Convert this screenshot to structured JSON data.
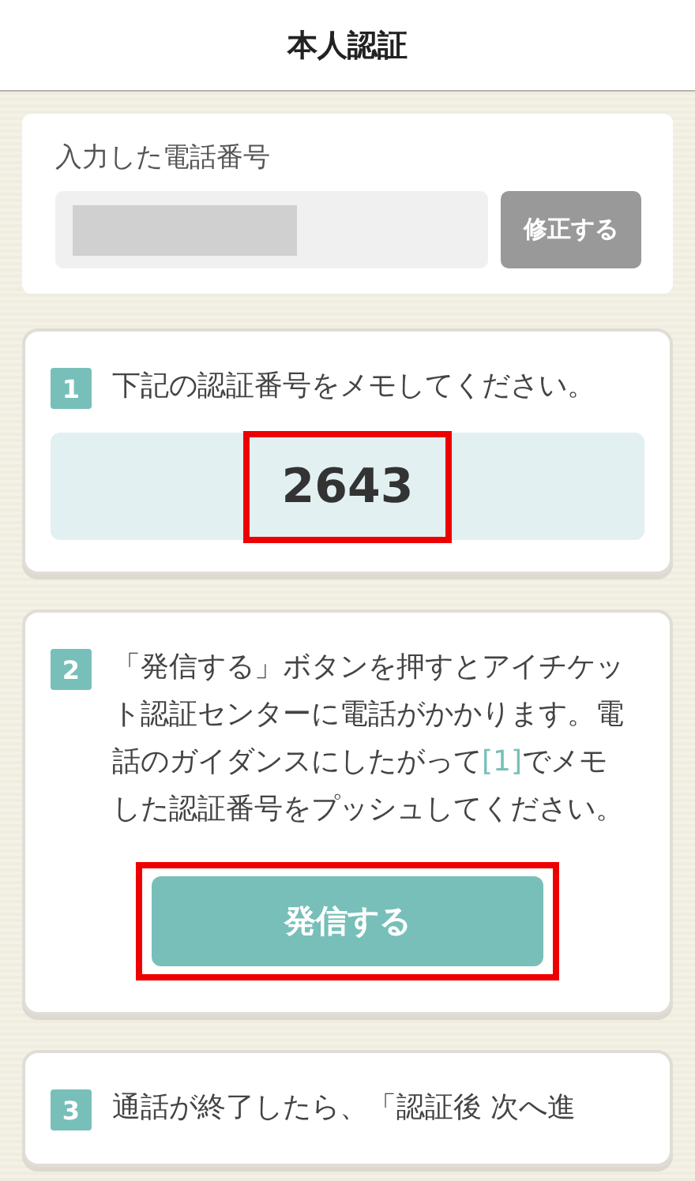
{
  "header": {
    "title": "本人認証"
  },
  "phone": {
    "label": "入力した電話番号",
    "edit_button": "修正する"
  },
  "steps": [
    {
      "kind": "code",
      "number": "1",
      "text": "下記の認証番号をメモしてください。",
      "code": "2643",
      "highlighted": true
    },
    {
      "kind": "call",
      "number": "2",
      "text_before": "「発信する」ボタンを押すとアイチケット認証センターに電話がかかります。電話のガイダンスにしたがって",
      "ref": "[1]",
      "text_after": "でメモした認証番号をプッシュしてください。",
      "button": "発信する",
      "highlighted": true
    },
    {
      "kind": "text",
      "number": "3",
      "text": "通話が終了したら、「認証後 次へ進"
    }
  ]
}
